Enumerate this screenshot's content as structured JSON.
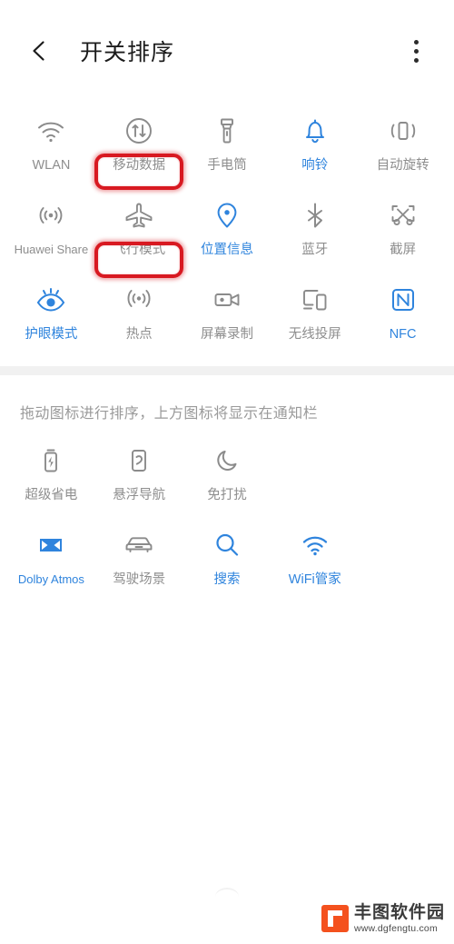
{
  "header": {
    "title": "开关排序",
    "back_icon": "arrow-left-icon",
    "menu_icon": "kebab-menu-icon"
  },
  "colors": {
    "active": "#2f84dd",
    "inactive": "#8e8e8e",
    "annotation": "#d81921",
    "divider": "#f1f1f1",
    "watermark": "#f4511e"
  },
  "notification_panel": {
    "tiles": [
      {
        "label": "WLAN",
        "icon": "wifi-icon",
        "state": "off"
      },
      {
        "label": "移动数据",
        "icon": "mobile-data-icon",
        "state": "off"
      },
      {
        "label": "手电筒",
        "icon": "flashlight-icon",
        "state": "off"
      },
      {
        "label": "响铃",
        "icon": "bell-icon",
        "state": "on"
      },
      {
        "label": "自动旋转",
        "icon": "auto-rotate-icon",
        "state": "off"
      },
      {
        "label": "Huawei Share",
        "icon": "huawei-share-icon",
        "state": "off"
      },
      {
        "label": "飞行模式",
        "icon": "airplane-icon",
        "state": "off"
      },
      {
        "label": "位置信息",
        "icon": "location-pin-icon",
        "state": "on"
      },
      {
        "label": "蓝牙",
        "icon": "bluetooth-icon",
        "state": "off"
      },
      {
        "label": "截屏",
        "icon": "screenshot-icon",
        "state": "off"
      },
      {
        "label": "护眼模式",
        "icon": "eye-comfort-icon",
        "state": "on"
      },
      {
        "label": "热点",
        "icon": "hotspot-icon",
        "state": "off"
      },
      {
        "label": "屏幕录制",
        "icon": "screen-record-icon",
        "state": "off"
      },
      {
        "label": "无线投屏",
        "icon": "cast-screen-icon",
        "state": "off"
      },
      {
        "label": "NFC",
        "icon": "nfc-icon",
        "state": "on"
      }
    ]
  },
  "hint": {
    "text": "拖动图标进行排序，上方图标将显示在通知栏"
  },
  "hidden_panel": {
    "tiles": [
      {
        "label": "超级省电",
        "icon": "battery-saver-icon",
        "state": "off"
      },
      {
        "label": "悬浮导航",
        "icon": "floating-nav-icon",
        "state": "off"
      },
      {
        "label": "免打扰",
        "icon": "moon-dnd-icon",
        "state": "off"
      },
      {
        "label": "Dolby Atmos",
        "icon": "dolby-atmos-icon",
        "state": "on"
      },
      {
        "label": "驾驶场景",
        "icon": "car-driving-icon",
        "state": "off"
      },
      {
        "label": "搜索",
        "icon": "search-icon",
        "state": "on"
      },
      {
        "label": "WiFi管家",
        "icon": "wifi-manager-icon",
        "state": "on"
      }
    ]
  },
  "annotations": [
    {
      "id": "annot-mobile-data",
      "targets": "移动数据"
    },
    {
      "id": "annot-airplane",
      "targets": "飞行模式"
    }
  ],
  "watermark": {
    "title": "丰图软件园",
    "url": "www.dgfengtu.com"
  }
}
